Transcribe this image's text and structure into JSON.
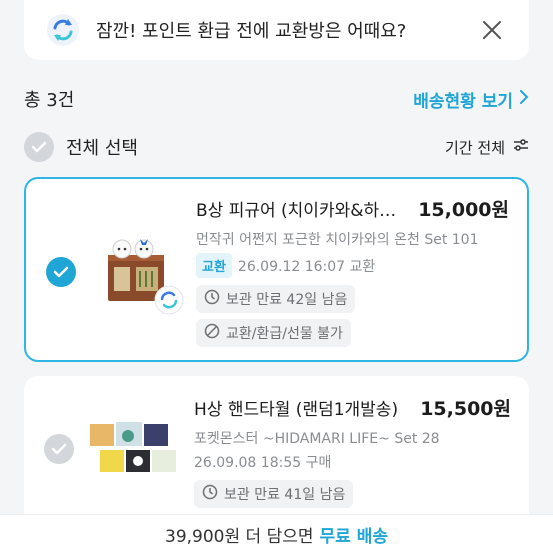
{
  "banner": {
    "text": "잠깐! 포인트 환급 전에 교환방은 어때요?",
    "icon": "refresh-icon",
    "close_icon": "close-icon"
  },
  "summary": {
    "count_label": "총 3건",
    "delivery_link": "배송현황 보기"
  },
  "selection": {
    "select_all_label": "전체 선택",
    "period_label": "기간 전체"
  },
  "items": [
    {
      "title": "B상 피규어 (치이카와&하…",
      "price": "15,000원",
      "subtitle": "먼작귀 어쩐지 포근한 치이카와의 온천 Set 101",
      "tag": "교환",
      "meta": "26.09.12 16:07 교환",
      "chips": [
        "보관 만료 42일 남음",
        "교환/환급/선물 불가"
      ],
      "selected": true
    },
    {
      "title": "H상 핸드타월 (랜덤1개발송)",
      "price": "15,500원",
      "subtitle": "포켓몬스터 ~HIDAMARI LIFE~ Set 28",
      "meta": "26.09.08 18:55 구매",
      "chips": [
        "보관 만료 41일 남음"
      ],
      "selected": false
    }
  ],
  "footer": {
    "amount_text": "39,900원 더 담으면",
    "free_text": "무료 배송"
  },
  "colors": {
    "accent": "#1fa5d6",
    "card_border": "#2fb5e3",
    "background": "#f4f5f7"
  }
}
